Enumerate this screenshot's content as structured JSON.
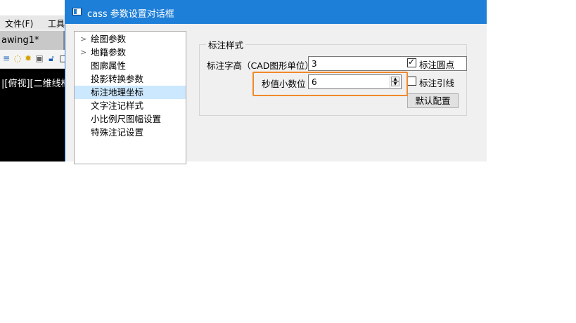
{
  "background_app": {
    "menu": [
      {
        "label": "文件(F)"
      },
      {
        "label": "工具"
      }
    ],
    "drawing_tab": "awing1*",
    "view_label": "|[俯视][二维线框"
  },
  "dialog": {
    "title": "cass 参数设置对话框",
    "tree": [
      {
        "label": "绘图参数",
        "expandable": true,
        "selected": false
      },
      {
        "label": "地籍参数",
        "expandable": true,
        "selected": false
      },
      {
        "label": "图廓属性",
        "expandable": false,
        "selected": false
      },
      {
        "label": "投影转换参数",
        "expandable": false,
        "selected": false
      },
      {
        "label": "标注地理坐标",
        "expandable": false,
        "selected": true
      },
      {
        "label": "文字注记样式",
        "expandable": false,
        "selected": false
      },
      {
        "label": "小比例尺图幅设置",
        "expandable": false,
        "selected": false
      },
      {
        "label": "特殊注记设置",
        "expandable": false,
        "selected": false
      }
    ],
    "group": {
      "title": "标注样式",
      "height_label": "标注字高（CAD图形单位）",
      "height_value": "3",
      "decimal_label": "秒值小数位",
      "decimal_value": "6",
      "dot_checkbox": {
        "label": "标注圆点",
        "checked": true
      },
      "leader_checkbox": {
        "label": "标注引线",
        "checked": false
      },
      "default_button": "默认配置"
    }
  },
  "colors": {
    "titlebar": "#1e7fd8",
    "selection": "#cce8ff",
    "highlight": "#f0892b"
  }
}
